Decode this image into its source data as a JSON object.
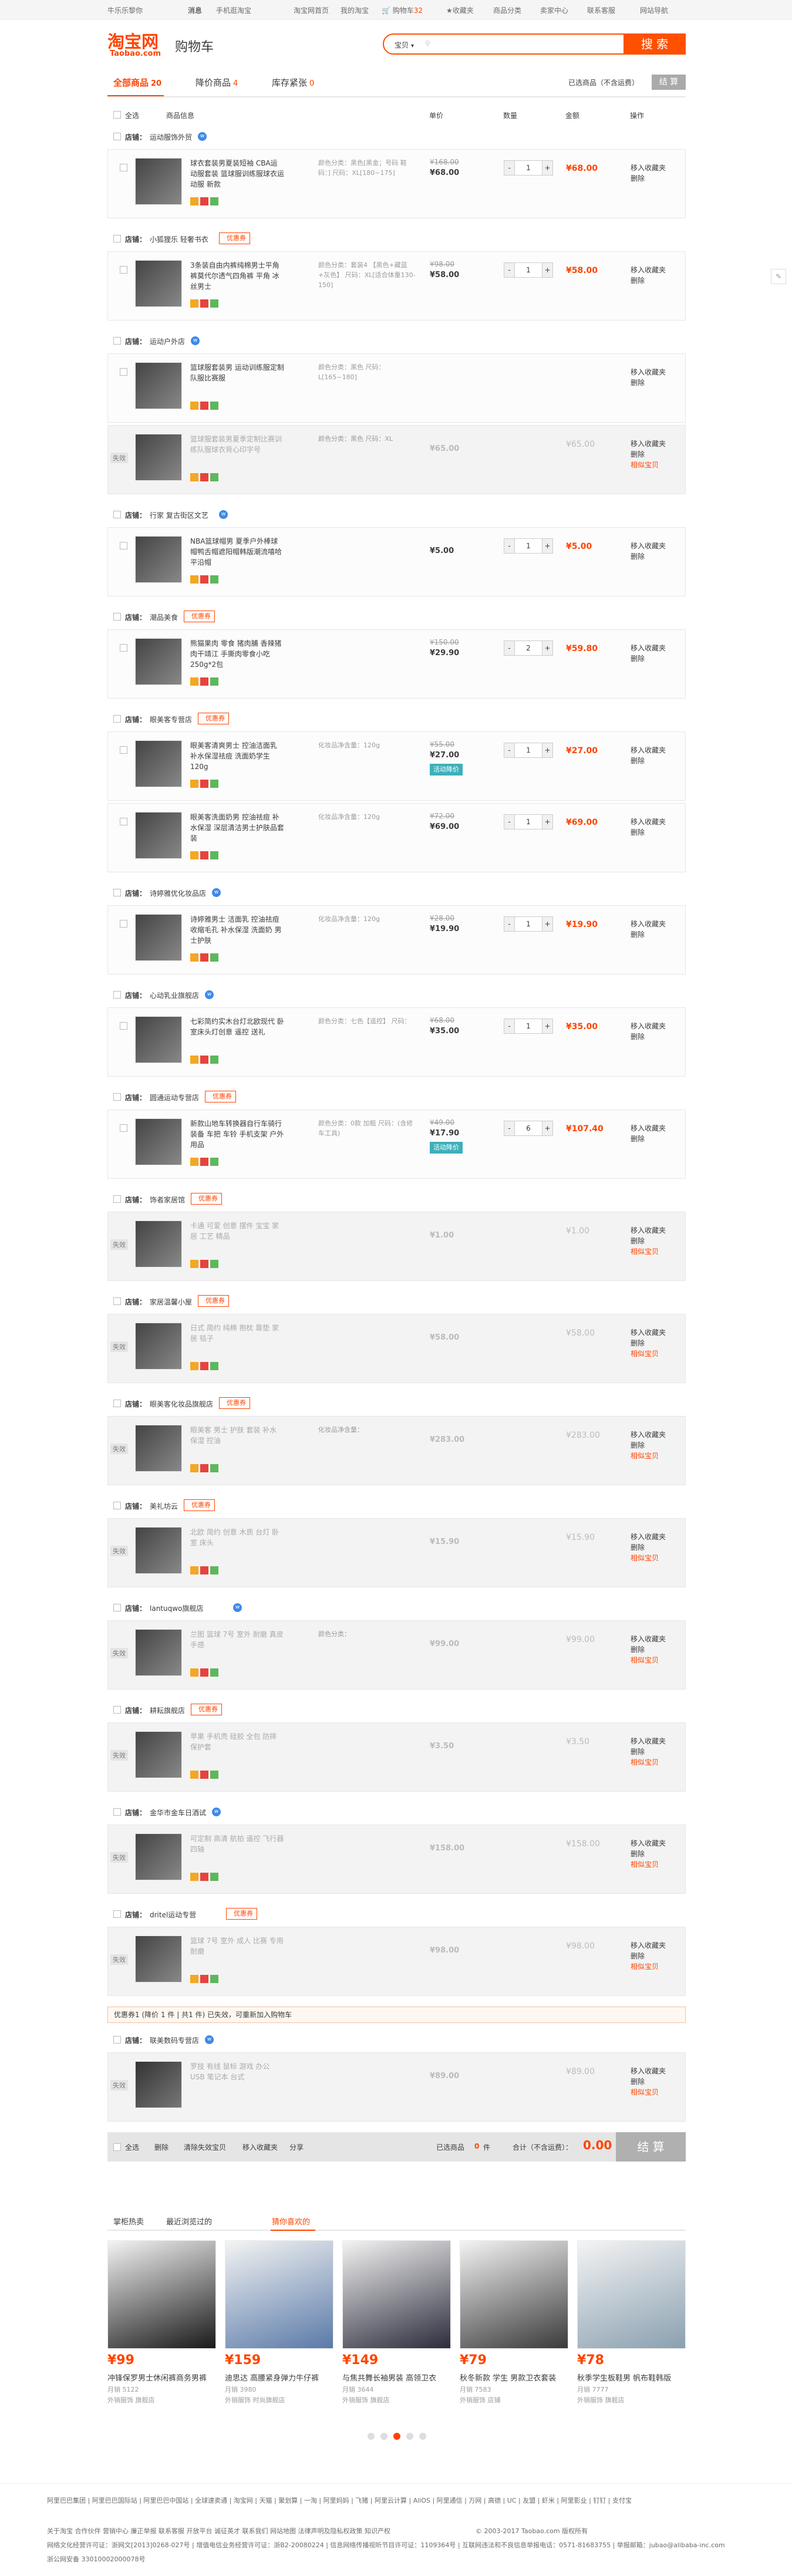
{
  "topbar": {
    "greeting": "牛乐乐黎你",
    "msg": "消息",
    "mobile": "手机逛淘宝",
    "home": "淘宝网首页",
    "my": "我的淘宝",
    "cart": "购物车",
    "cart_count": "32",
    "fav": "收藏夹",
    "cats": "商品分类",
    "seller": "卖家中心",
    "service": "联系客服",
    "sitenav": "网站导航"
  },
  "header": {
    "logo_cn": "淘宝网",
    "logo_en": "Taobao.com",
    "cart_word": "购物车",
    "search_scope": "宝贝",
    "search_btn": "搜 索"
  },
  "tabs": {
    "all": "全部商品",
    "all_count": "20",
    "reduced": "降价商品",
    "reduced_count": "4",
    "low": "库存紧张",
    "low_count": "0",
    "selected_text": "已选商品（不含运费）",
    "settle": "结 算"
  },
  "cols": {
    "all": "全选",
    "info": "商品信息",
    "price": "单价",
    "qty": "数量",
    "amount": "金额",
    "op": "操作"
  },
  "ops": {
    "fav": "移入收藏夹",
    "del": "删除",
    "sim": "相似宝贝"
  },
  "coupon": "优惠券",
  "shops": [
    {
      "name": "运动服饰外贸",
      "coupon": false,
      "items": [
        {
          "title": "球衣套装男夏装短袖 CBA运动服套装 篮球服训练服球衣运动服 新款",
          "sku": "颜色分类：黑色[黑金；号码 鞋码：]  尺码：XL[180~175]",
          "oprice": "¥168.00",
          "price": "¥68.00",
          "qty": "1",
          "total": "¥68.00",
          "inv": false
        }
      ]
    },
    {
      "name": "小狐狸乐 轻奢书衣",
      "coupon": true,
      "items": [
        {
          "title": "3条装自由内裤纯棉男士平角裤莫代尔透气四角裤 平角 冰丝男士",
          "sku": "颜色分类：套装4 【黑色+藏蓝+灰色】  尺码：XL[适合体重130-150]",
          "oprice": "¥98.00",
          "price": "¥58.00",
          "qty": "1",
          "total": "¥58.00",
          "inv": false
        }
      ]
    },
    {
      "name": "运动户外店",
      "coupon": false,
      "items": [
        {
          "title": "篮球服套装男 运动训练服定制 队服比赛服",
          "sku": "颜色分类：黑色  尺码：L[165~180]",
          "oprice": "",
          "price": "",
          "qty": "",
          "total": "",
          "inv": false
        },
        {
          "title": "篮球服套装男夏季定制比赛训练队服球衣背心印字号",
          "sku": "颜色分类：黑色  尺码：XL",
          "oprice": "",
          "price": "¥65.00",
          "qty": "",
          "total": "¥65.00",
          "inv": true
        }
      ]
    },
    {
      "name": "行家 复古街区文艺",
      "coupon": false,
      "items": [
        {
          "title": "NBA篮球帽男 夏季户外棒球帽鸭舌帽遮阳帽韩版潮流嘻哈平沿帽",
          "sku": "",
          "oprice": "",
          "price": "¥5.00",
          "qty": "1",
          "total": "¥5.00",
          "inv": false
        }
      ]
    },
    {
      "name": "潮品美食",
      "coupon": true,
      "items": [
        {
          "title": "熊猫果肉 零食 猪肉脯 香辣猪肉干靖江 手撕肉零食小吃250g*2包",
          "sku": "",
          "oprice": "¥150.00",
          "price": "¥29.90",
          "qty": "2",
          "total": "¥59.80",
          "inv": false
        }
      ]
    },
    {
      "name": "眼美客专营店",
      "coupon": true,
      "items": [
        {
          "title": "眼美客清爽男士 控油洁面乳 补水保湿祛痘 洗面奶学生120g",
          "sku": "化妆品净含量：120g",
          "oprice": "¥55.00",
          "price": "¥27.00",
          "promo": "活动降价",
          "qty": "1",
          "total": "¥27.00",
          "inv": false
        },
        {
          "title": "眼美客洗面奶男 控油祛痘 补水保湿 深层清洁男士护肤品套装",
          "sku": "化妆品净含量：120g",
          "oprice": "¥72.00",
          "price": "¥69.00",
          "qty": "1",
          "total": "¥69.00",
          "inv": false
        }
      ]
    },
    {
      "name": "诗婷雅优化妆品店",
      "coupon": false,
      "items": [
        {
          "title": "诗婷雅男士 洁面乳 控油祛痘 收缩毛孔 补水保湿 洗面奶 男士护肤",
          "sku": "化妆品净含量：120g",
          "oprice": "¥28.00",
          "price": "¥19.90",
          "qty": "1",
          "total": "¥19.90",
          "inv": false
        }
      ]
    },
    {
      "name": "心动乳业旗舰店",
      "coupon": false,
      "items": [
        {
          "title": "七彩简约实木台灯北欧现代 卧室床头灯创意 遥控 送礼",
          "sku": "颜色分类：七色【遥控】  尺码：",
          "oprice": "¥68.00",
          "price": "¥35.00",
          "qty": "1",
          "total": "¥35.00",
          "inv": false
        }
      ]
    },
    {
      "name": "圆通运动专营店",
      "coupon": true,
      "items": [
        {
          "title": "新款山地车转换器自行车骑行装备 车把 车铃 手机支架 户外用品",
          "sku": "颜色分类：0款 加粗 尺码：(含修车工具)",
          "oprice": "¥49.00",
          "price": "¥17.90",
          "promo": "活动降价",
          "qty": "6",
          "total": "¥107.40",
          "inv": false
        }
      ]
    },
    {
      "name": "饰者家居馆",
      "coupon": true,
      "items": [
        {
          "title": "卡通 可爱 创意 摆件 宝宝 家居 工艺 精品",
          "sku": "",
          "oprice": "",
          "price": "¥1.00",
          "qty": "",
          "total": "¥1.00",
          "inv": true
        }
      ]
    },
    {
      "name": "家居温馨小屋",
      "coupon": true,
      "items": [
        {
          "title": "日式 简约 纯棉 抱枕 靠垫 家居 毯子",
          "sku": "",
          "oprice": "",
          "price": "¥58.00",
          "qty": "",
          "total": "¥58.00",
          "inv": true
        }
      ]
    },
    {
      "name": "眼美客化妆品旗舰店",
      "coupon": true,
      "items": [
        {
          "title": "眼美客 男士 护肤 套装 补水 保湿 控油",
          "sku": "化妆品净含量：",
          "oprice": "",
          "price": "¥283.00",
          "qty": "",
          "total": "¥283.00",
          "inv": true
        }
      ]
    },
    {
      "name": "美礼坊云",
      "coupon": true,
      "items": [
        {
          "title": "北欧 简约 创意 木质 台灯 卧室 床头",
          "sku": "",
          "oprice": "",
          "price": "¥15.90",
          "qty": "",
          "total": "¥15.90",
          "inv": true
        }
      ]
    },
    {
      "name": "lantuqwo旗舰店",
      "coupon": false,
      "items": [
        {
          "title": "兰图 篮球 7号 室外 耐磨 真皮 手感",
          "sku": "颜色分类：",
          "oprice": "",
          "price": "¥99.00",
          "qty": "",
          "total": "¥99.00",
          "inv": true
        }
      ]
    },
    {
      "name": "耕耘旗舰店",
      "coupon": true,
      "items": [
        {
          "title": "苹果 手机壳 硅胶 全包 防摔 保护套",
          "sku": "",
          "oprice": "",
          "price": "¥3.50",
          "qty": "",
          "total": "¥3.50",
          "inv": true
        }
      ]
    },
    {
      "name": "金华市金车日酒试",
      "coupon": false,
      "items": [
        {
          "title": "可定制 高清 航拍 遥控 飞行器 四轴",
          "sku": "",
          "oprice": "",
          "price": "¥158.00",
          "qty": "",
          "total": "¥158.00",
          "inv": true
        }
      ]
    },
    {
      "name": "dritel运动专营",
      "coupon": true,
      "items": [
        {
          "title": "篮球 7号 室外 成人 比赛 专用 耐磨",
          "sku": "",
          "oprice": "",
          "price": "¥98.00",
          "qty": "",
          "total": "¥98.00",
          "inv": true
        }
      ]
    }
  ],
  "notice": "优惠券1 (降价 1 件 | 共1 件) 已失效，可重新加入购物车",
  "lastshop": {
    "name": "联美数码专营店",
    "items": [
      {
        "title": "罗技 有线 鼠标 游戏 办公 USB 笔记本 台式",
        "sku": "",
        "oprice": "",
        "price": "¥89.00",
        "qty": "",
        "total": "¥89.00",
        "inv": true
      }
    ]
  },
  "bar": {
    "all": "全选",
    "del": "删除",
    "delinv": "清除失效宝贝",
    "fav": "移入收藏夹",
    "share": "分享",
    "selected": "已选商品",
    "selected_n": "0",
    "unit": "件",
    "sum_label": "合计（不含运费）：",
    "sum": "0.00",
    "go": "结 算"
  },
  "rec": {
    "tabs": [
      "掌柜热卖",
      "最近浏览过的",
      "猜你喜欢的"
    ],
    "cards": [
      {
        "price": "¥99",
        "name": "冲锋保罗男士休闲裤商务男裤",
        "sales": "月销 5122",
        "shop": "外销服饰 旗舰店"
      },
      {
        "price": "¥159",
        "name": "迪思达 高腰紧身弹力牛仔裤",
        "sales": "月销 3980",
        "shop": "外销服饰 时尚旗舰店"
      },
      {
        "price": "¥149",
        "name": "与焦共舞长袖男装 高领卫衣",
        "sales": "月销 3644",
        "shop": "外销服饰 旗舰店"
      },
      {
        "price": "¥79",
        "name": "秋冬新款 学生 男款卫衣套装",
        "sales": "月销 7583",
        "shop": "外销服饰 店铺"
      },
      {
        "price": "¥78",
        "name": "秋季学生板鞋男 帆布鞋韩版",
        "sales": "月销 7777",
        "shop": "外销服饰 旗舰店"
      }
    ]
  },
  "footer": {
    "row1": "阿里巴巴集团 | 阿里巴巴国际站 | 阿里巴巴中国站 | 全球速卖通 | 淘宝网 | 天猫 | 聚划算 | 一淘 | 阿里妈妈 | 飞猪 | 阿里云计算 | AliOS | 阿里通信 | 万网 | 高德 | UC | 友盟 | 虾米 | 阿里影业 | 钉钉 | 支付宝",
    "row2": "关于淘宝 合作伙伴 营销中心 廉正举报 联系客服 开放平台 诚征英才 联系我们 网站地图 法律声明及隐私权政策 知识产权",
    "copy": "© 2003-2017 Taobao.com 版权所有",
    "row3": "网络文化经营许可证：浙网文[2013]0268-027号 | 增值电信业务经营许可证：浙B2-20080224 | 信息网络传播视听节目许可证：1109364号 | 互联网违法和不良信息举报电话：0571-81683755 | 举报邮箱：jubao@alibaba-inc.com",
    "row4": "浙公网安备 33010002000078号"
  }
}
